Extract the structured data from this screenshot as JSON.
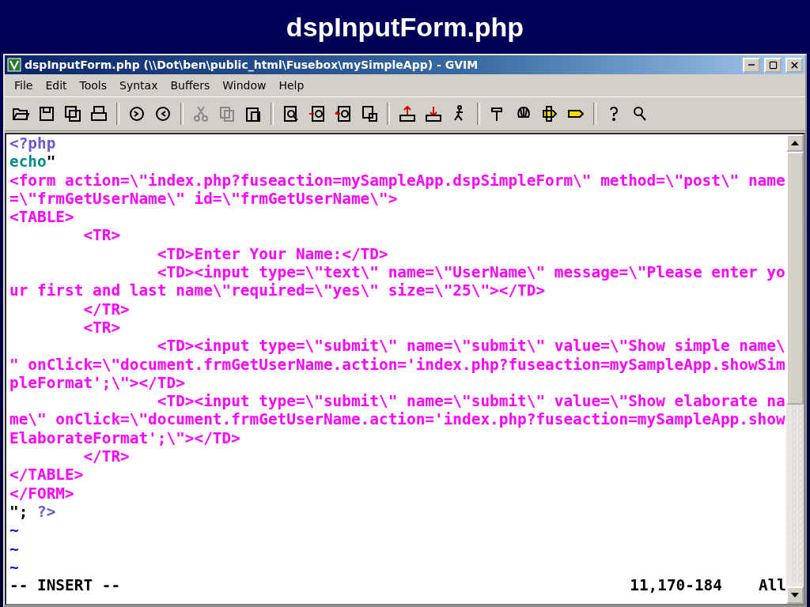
{
  "slide_title": "dspInputForm.php",
  "window": {
    "title": "dspInputForm.php (\\\\Dot\\ben\\public_html\\Fusebox\\mySimpleApp) - GVIM"
  },
  "menu": [
    "File",
    "Edit",
    "Tools",
    "Syntax",
    "Buffers",
    "Window",
    "Help"
  ],
  "editor": {
    "lines": [
      [
        {
          "text": "<?php",
          "kind": "php"
        }
      ],
      [
        {
          "text": "echo",
          "kind": "keyword"
        },
        {
          "text": "\"",
          "kind": "plain"
        }
      ],
      [
        {
          "text": "<form action=\\\"index.php?fuseaction=mySampleApp.dspSimpleForm\\\" method=\\\"post\\\" name",
          "kind": "string"
        }
      ],
      [
        {
          "text": "=\\\"frmGetUserName\\\" id=\\\"frmGetUserName\\\">",
          "kind": "string"
        }
      ],
      [
        {
          "text": "<TABLE>",
          "kind": "string"
        }
      ],
      [
        {
          "text": "        <TR>",
          "kind": "string"
        }
      ],
      [
        {
          "text": "                <TD>Enter Your Name:</TD>",
          "kind": "string"
        }
      ],
      [
        {
          "text": "                <TD><input type=\\\"text\\\" name=\\\"UserName\\\" message=\\\"Please enter yo",
          "kind": "string"
        }
      ],
      [
        {
          "text": "ur first and last name\\\"required=\\\"yes\\\" size=\\\"25\\\"></TD>",
          "kind": "string"
        }
      ],
      [
        {
          "text": "        </TR>",
          "kind": "string"
        }
      ],
      [
        {
          "text": "        <TR>",
          "kind": "string"
        }
      ],
      [
        {
          "text": "                <TD><input type=\\\"submit\\\" name=\\\"submit\\\" value=\\\"Show simple name\\",
          "kind": "string"
        }
      ],
      [
        {
          "text": "\" onClick=\\\"document.frmGetUserName.action='index.php?fuseaction=mySampleApp.showSim",
          "kind": "string"
        }
      ],
      [
        {
          "text": "pleFormat';\\\"></TD>",
          "kind": "string"
        }
      ],
      [
        {
          "text": "                <TD><input type=\\\"submit\\\" name=\\\"submit\\\" value=\\\"Show elaborate na",
          "kind": "string"
        }
      ],
      [
        {
          "text": "me\\\" onClick=\\\"document.frmGetUserName.action='index.php?fuseaction=mySampleApp.show",
          "kind": "string"
        }
      ],
      [
        {
          "text": "ElaborateFormat';\\\"></TD>",
          "kind": "string"
        }
      ],
      [
        {
          "text": "        </TR>",
          "kind": "string"
        }
      ],
      [
        {
          "text": "</TABLE>",
          "kind": "string"
        }
      ],
      [
        {
          "text": "</FORM>",
          "kind": "string"
        }
      ],
      [
        {
          "text": "\"; ",
          "kind": "plain"
        },
        {
          "text": "?>",
          "kind": "php"
        }
      ],
      [
        {
          "text": "~",
          "kind": "tilde"
        }
      ],
      [
        {
          "text": "~",
          "kind": "tilde"
        }
      ],
      [
        {
          "text": "~",
          "kind": "tilde"
        }
      ]
    ]
  },
  "status_bar": {
    "mode": "-- INSERT --",
    "position": "11,170-184",
    "scroll": "All"
  }
}
